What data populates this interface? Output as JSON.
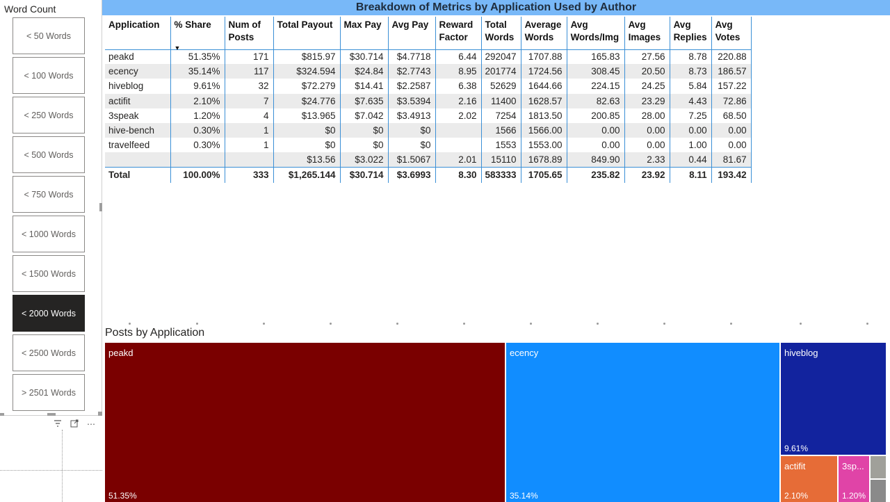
{
  "slicer": {
    "title": "Word Count",
    "items": [
      {
        "label": "< 50 Words",
        "active": false
      },
      {
        "label": "< 100 Words",
        "active": false
      },
      {
        "label": "< 250 Words",
        "active": false
      },
      {
        "label": "< 500 Words",
        "active": false
      },
      {
        "label": "< 750 Words",
        "active": false
      },
      {
        "label": "< 1000 Words",
        "active": false
      },
      {
        "label": "< 1500 Words",
        "active": false
      },
      {
        "label": "< 2000 Words",
        "active": true
      },
      {
        "label": "< 2500 Words",
        "active": false
      },
      {
        "label": "> 2501 Words",
        "active": false
      }
    ]
  },
  "table": {
    "title": "Breakdown of Metrics by Application Used by Author",
    "columns": [
      "Application",
      "% Share",
      "Num of Posts",
      "Total Payout",
      "Max Pay",
      "Avg Pay",
      "Reward Factor",
      "Total Words",
      "Average Words",
      "Avg Words/Img",
      "Avg Images",
      "Avg Replies",
      "Avg Votes"
    ],
    "column_lines": [
      [
        "Application"
      ],
      [
        "% Share"
      ],
      [
        "Num of",
        "Posts"
      ],
      [
        "Total Payout"
      ],
      [
        "Max Pay"
      ],
      [
        "Avg Pay"
      ],
      [
        "Reward",
        "Factor"
      ],
      [
        "Total",
        "Words"
      ],
      [
        "Average",
        "Words"
      ],
      [
        "Avg",
        "Words/Img"
      ],
      [
        "Avg",
        "Images"
      ],
      [
        "Avg",
        "Replies"
      ],
      [
        "Avg",
        "Votes"
      ]
    ],
    "rows": [
      [
        "peakd",
        "51.35%",
        "171",
        "$815.97",
        "$30.714",
        "$4.7718",
        "6.44",
        "292047",
        "1707.88",
        "165.83",
        "27.56",
        "8.78",
        "220.88"
      ],
      [
        "ecency",
        "35.14%",
        "117",
        "$324.594",
        "$24.84",
        "$2.7743",
        "8.95",
        "201774",
        "1724.56",
        "308.45",
        "20.50",
        "8.73",
        "186.57"
      ],
      [
        "hiveblog",
        "9.61%",
        "32",
        "$72.279",
        "$14.41",
        "$2.2587",
        "6.38",
        "52629",
        "1644.66",
        "224.15",
        "24.25",
        "5.84",
        "157.22"
      ],
      [
        "actifit",
        "2.10%",
        "7",
        "$24.776",
        "$7.635",
        "$3.5394",
        "2.16",
        "11400",
        "1628.57",
        "82.63",
        "23.29",
        "4.43",
        "72.86"
      ],
      [
        "3speak",
        "1.20%",
        "4",
        "$13.965",
        "$7.042",
        "$3.4913",
        "2.02",
        "7254",
        "1813.50",
        "200.85",
        "28.00",
        "7.25",
        "68.50"
      ],
      [
        "hive-bench",
        "0.30%",
        "1",
        "$0",
        "$0",
        "$0",
        "",
        "1566",
        "1566.00",
        "0.00",
        "0.00",
        "0.00",
        "0.00"
      ],
      [
        "travelfeed",
        "0.30%",
        "1",
        "$0",
        "$0",
        "$0",
        "",
        "1553",
        "1553.00",
        "0.00",
        "0.00",
        "1.00",
        "0.00"
      ],
      [
        "",
        "",
        "",
        "$13.56",
        "$3.022",
        "$1.5067",
        "2.01",
        "15110",
        "1678.89",
        "849.90",
        "2.33",
        "0.44",
        "81.67"
      ]
    ],
    "total": [
      "Total",
      "100.00%",
      "333",
      "$1,265.144",
      "$30.714",
      "$3.6993",
      "8.30",
      "583333",
      "1705.65",
      "235.82",
      "23.92",
      "8.11",
      "193.42"
    ]
  },
  "treemap": {
    "title": "Posts by Application",
    "tiles": [
      {
        "label": "peakd",
        "pct": "51.35%",
        "color": "#7a0000"
      },
      {
        "label": "ecency",
        "pct": "35.14%",
        "color": "#118dff"
      },
      {
        "label": "hiveblog",
        "pct": "9.61%",
        "color": "#12239e"
      },
      {
        "label": "actifit",
        "pct": "2.10%",
        "color": "#e66c37"
      },
      {
        "label": "3sp...",
        "pct": "1.20%",
        "color": "#e044a7"
      },
      {
        "label": "",
        "pct": "",
        "color": "#a0a09a"
      },
      {
        "label": "",
        "pct": "",
        "color": "#8a8a8a"
      }
    ]
  },
  "icons": {
    "filter": "filter-icon",
    "focus": "focus-mode-icon",
    "more": "more-options-icon"
  }
}
